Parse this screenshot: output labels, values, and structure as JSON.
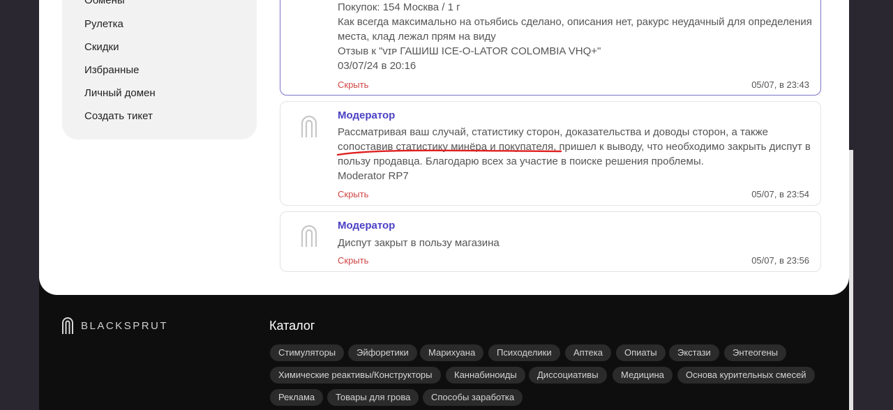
{
  "sidebar": {
    "items": [
      {
        "label": "Обмены"
      },
      {
        "label": "Рулетка"
      },
      {
        "label": "Скидки"
      },
      {
        "label": "Избранные"
      },
      {
        "label": "Личный домен"
      },
      {
        "label": "Создать тикет"
      }
    ]
  },
  "messages": [
    {
      "text": "Покупок: 154 Москва / 1 г\nКак всегда максимально на отьябись сделано, описания нет, ракурс неудачный для определения места, клад лежал прям на виду\nОтзыв к \"ᴠɪᴘ ГАШИШ ICE-O-LATOR COLOMBIA VHQ+\"\n03/07/24 в 20:16",
      "hide_label": "Скрыть",
      "time": "05/07, в 23:43"
    },
    {
      "author": "Модератор",
      "text": "Рассматривая ваш случай, статистику сторон, доказательства и доводы сторон, а также сопоставив статистику минёра и покупателя, пришел к выводу, что необходимо закрыть диспут в пользу продавца. Благодарю всех за участие в поиске решения проблемы.\nModerator RP7",
      "hide_label": "Скрыть",
      "time": "05/07, в 23:54"
    },
    {
      "author": "Модератор",
      "text": "Диспут закрыт в пользу магазина",
      "hide_label": "Скрыть",
      "time": "05/07, в 23:56"
    }
  ],
  "footer": {
    "brand": "BLACKSPRUT",
    "catalog_title": "Каталог",
    "tags": [
      "Стимуляторы",
      "Эйфоретики",
      "Марихуана",
      "Психоделики",
      "Аптека",
      "Опиаты",
      "Экстази",
      "Энтеогены",
      "Химические реактивы/Конструкторы",
      "Каннабиноиды",
      "Диссоциативы",
      "Медицина",
      "Основа курительных смесей",
      "Реклама",
      "Товары для грова",
      "Способы заработка"
    ]
  },
  "colors": {
    "accent": "#4a3fc4",
    "hide_link": "#d04545",
    "annotation_underline": "#e02020"
  }
}
